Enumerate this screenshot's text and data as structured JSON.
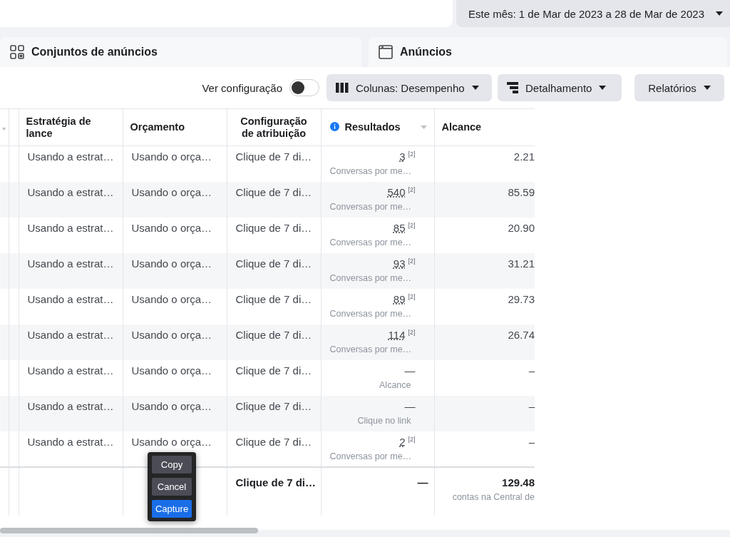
{
  "date_range": {
    "label": "Este mês: 1 de Mar de 2023 a 28 de Mar de 2023"
  },
  "tabs": [
    {
      "label": "Conjuntos de anúncios"
    },
    {
      "label": "Anúncios"
    }
  ],
  "toolbar": {
    "toggle": {
      "label": "Ver configuração",
      "on": false
    },
    "buttons": [
      {
        "label": "Colunas: Desempenho"
      },
      {
        "label": "Detalhamento"
      },
      {
        "label": "Relatórios"
      }
    ]
  },
  "table": {
    "columns": [
      "Estratégia de lance",
      "Orçamento",
      "Configuração de atribuição",
      "Resultados",
      "Alcance"
    ],
    "rows": [
      {
        "bid": "Usando a estrat…",
        "budget": "Usando o orça…",
        "attribution": "Clique de 7 di…",
        "result": "3",
        "result_note": "[2]",
        "result_type": "Conversas por me…",
        "reach": "2.21"
      },
      {
        "bid": "Usando a estrat…",
        "budget": "Usando o orça…",
        "attribution": "Clique de 7 di…",
        "result": "540",
        "result_note": "[2]",
        "result_type": "Conversas por me…",
        "reach": "85.59"
      },
      {
        "bid": "Usando a estrat…",
        "budget": "Usando o orça…",
        "attribution": "Clique de 7 di…",
        "result": "85",
        "result_note": "[2]",
        "result_type": "Conversas por me…",
        "reach": "20.90"
      },
      {
        "bid": "Usando a estrat…",
        "budget": "Usando o orça…",
        "attribution": "Clique de 7 di…",
        "result": "93",
        "result_note": "[2]",
        "result_type": "Conversas por me…",
        "reach": "31.21"
      },
      {
        "bid": "Usando a estrat…",
        "budget": "Usando o orça…",
        "attribution": "Clique de 7 di…",
        "result": "89",
        "result_note": "[2]",
        "result_type": "Conversas por me…",
        "reach": "29.73"
      },
      {
        "bid": "Usando a estrat…",
        "budget": "Usando o orça…",
        "attribution": "Clique de 7 di…",
        "result": "114",
        "result_note": "[2]",
        "result_type": "Conversas por me…",
        "reach": "26.74"
      },
      {
        "bid": "Usando a estrat…",
        "budget": "Usando o orça…",
        "attribution": "Clique de 7 di…",
        "result": "—",
        "result_type": "Alcance",
        "reach": "–"
      },
      {
        "bid": "Usando a estrat…",
        "budget": "Usando o orça…",
        "attribution": "Clique de 7 di…",
        "result": "—",
        "result_type": "Clique no link",
        "reach": "–"
      },
      {
        "bid": "Usando a estrat…",
        "budget": "Usando o orça…",
        "attribution": "Clique de 7 di…",
        "result": "2",
        "result_note": "[2]",
        "result_type": "Conversas por me…",
        "reach": "–"
      }
    ],
    "summary": {
      "attribution": "Clique de 7 di…",
      "result": "—",
      "reach": "129.48",
      "reach_note": "contas na Central de"
    }
  },
  "context_menu": [
    {
      "label": "Copy",
      "selected": false
    },
    {
      "label": "Cancel",
      "selected": false
    },
    {
      "label": "Capture",
      "selected": true
    }
  ]
}
